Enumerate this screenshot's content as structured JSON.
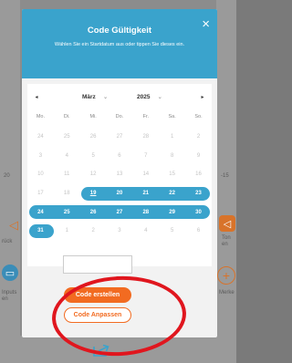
{
  "modal": {
    "title": "Code Gültigkeit",
    "subtitle": "Wählen Sie ein Startdatum aus oder tippen Sie dieses ein.",
    "close_glyph": "×"
  },
  "calendar": {
    "prev_glyph": "◂",
    "next_glyph": "▸",
    "month": "März",
    "year": "2025",
    "chevron": "⌄",
    "weekdays": [
      "Mo.",
      "Di.",
      "Mi.",
      "Do.",
      "Fr.",
      "Sa.",
      "So."
    ],
    "weeks": [
      [
        "24",
        "25",
        "26",
        "27",
        "28",
        "1",
        "2"
      ],
      [
        "3",
        "4",
        "5",
        "6",
        "7",
        "8",
        "9"
      ],
      [
        "10",
        "11",
        "12",
        "13",
        "14",
        "15",
        "16"
      ],
      [
        "17",
        "18",
        "19",
        "20",
        "21",
        "22",
        "23"
      ],
      [
        "24",
        "25",
        "26",
        "27",
        "28",
        "29",
        "30"
      ],
      [
        "31",
        "1",
        "2",
        "3",
        "4",
        "5",
        "6"
      ]
    ],
    "selected_start": "19"
  },
  "buttons": {
    "create": "Code erstellen",
    "adjust": "Code Anpassen"
  },
  "side": {
    "left_label_1": "rück",
    "left_label_2": "Inputs\nen",
    "right_label_1": "Ton\nen",
    "right_label_2": "Merke",
    "left_num": "20",
    "right_num": "-15",
    "plus": "+"
  },
  "colors": {
    "accent": "#3aa3cc",
    "orange": "#f26b21",
    "annotation": "#e0161e"
  }
}
